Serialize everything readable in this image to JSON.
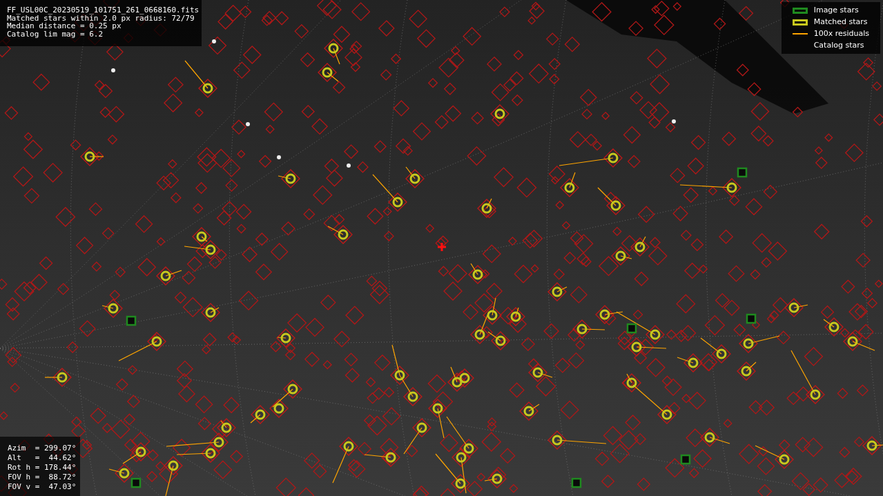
{
  "info_lines": [
    "FF_USL00C_20230519_101751_261_0668160.fits",
    "Matched stars within 2.0 px radius: 72/79",
    "Median distance = 0.25 px",
    "Catalog lim mag = 6.2"
  ],
  "legend": [
    {
      "label": "Image stars",
      "kind": "box",
      "color": "#1f8a1f"
    },
    {
      "label": "Matched stars",
      "kind": "box",
      "color": "#c8c81e"
    },
    {
      "label": "100x residuals",
      "kind": "line",
      "color": "#ffa500"
    },
    {
      "label": "Catalog stars",
      "kind": "none"
    }
  ],
  "pointing": [
    "Azim  = 299.07°",
    "Alt   =  44.62°",
    "Rot h = 178.44°",
    "FOV h =  88.72°",
    "FOV v =  47.03°"
  ]
}
